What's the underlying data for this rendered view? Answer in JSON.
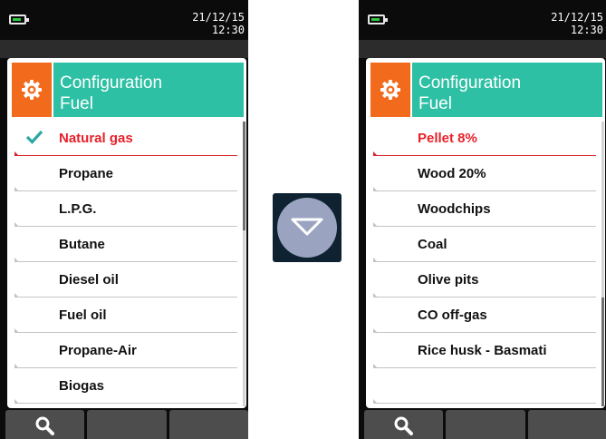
{
  "left_screen": {
    "clock": {
      "date": "21/12/15",
      "time": "12:30"
    },
    "battery_icon": "battery-icon",
    "header": {
      "line1": "Configuration",
      "line2": "Fuel",
      "icon": "gear-icon",
      "icon_color": "#f26b1d",
      "header_color": "#2ec0a4"
    },
    "items": [
      {
        "label": "Natural gas",
        "selected": true,
        "checked": true
      },
      {
        "label": "Propane"
      },
      {
        "label": "L.P.G."
      },
      {
        "label": "Butane"
      },
      {
        "label": "Diesel oil"
      },
      {
        "label": "Fuel oil"
      },
      {
        "label": "Propane-Air"
      },
      {
        "label": "Biogas"
      }
    ],
    "scroll_position": "top",
    "softkeys": [
      {
        "icon": "search-icon"
      },
      {
        "label": ""
      },
      {
        "label": ""
      }
    ]
  },
  "right_screen": {
    "clock": {
      "date": "21/12/15",
      "time": "12:30"
    },
    "battery_icon": "battery-icon",
    "header": {
      "line1": "Configuration",
      "line2": "Fuel",
      "icon": "gear-icon",
      "icon_color": "#f26b1d",
      "header_color": "#2ec0a4"
    },
    "items": [
      {
        "label": "Pellet 8%",
        "selected": true
      },
      {
        "label": "Wood 20%"
      },
      {
        "label": "Woodchips"
      },
      {
        "label": "Coal"
      },
      {
        "label": "Olive pits"
      },
      {
        "label": "CO off-gas"
      },
      {
        "label": "Rice husk - Basmati"
      },
      {
        "label": ""
      }
    ],
    "scroll_position": "bottom",
    "softkeys": [
      {
        "icon": "search-icon"
      },
      {
        "label": ""
      },
      {
        "label": ""
      }
    ]
  },
  "down_button": {
    "icon": "triangle-down-icon",
    "color": "#9aa4c0"
  },
  "colors": {
    "accent_red": "#e8202a",
    "check_teal": "#2ea7a4"
  }
}
